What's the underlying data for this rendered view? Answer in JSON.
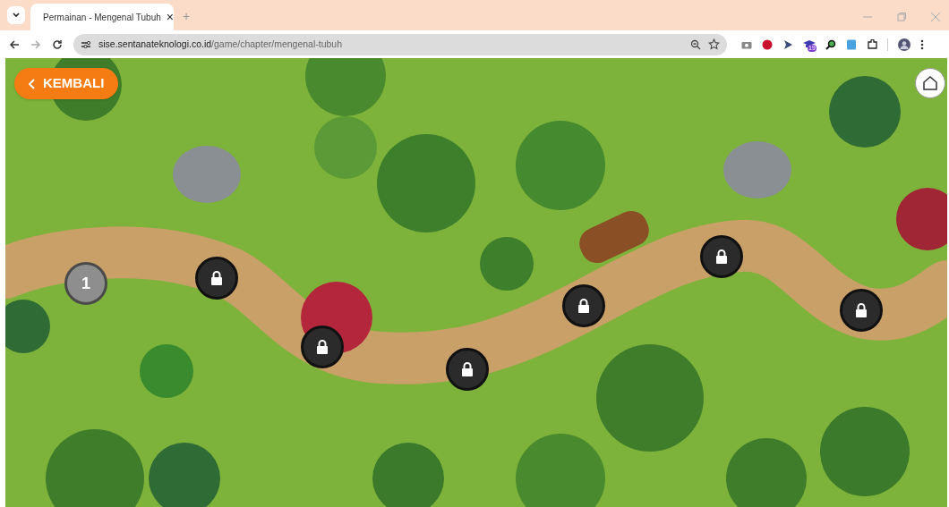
{
  "browser": {
    "tab": {
      "title": "Permainan - Mengenal Tubuh",
      "close": "×"
    },
    "new_tab": "+",
    "address": {
      "domain": "sise.sentanateknologi.co.id",
      "path": "/game/chapter/mengenal-tubuh"
    },
    "extension_badge": "19"
  },
  "game": {
    "back_button": {
      "label": "KEMBALI"
    },
    "levels": [
      {
        "kind": "unlocked",
        "label": "1"
      },
      {
        "kind": "locked"
      },
      {
        "kind": "locked"
      },
      {
        "kind": "locked"
      },
      {
        "kind": "locked"
      },
      {
        "kind": "locked"
      },
      {
        "kind": "locked"
      }
    ]
  }
}
